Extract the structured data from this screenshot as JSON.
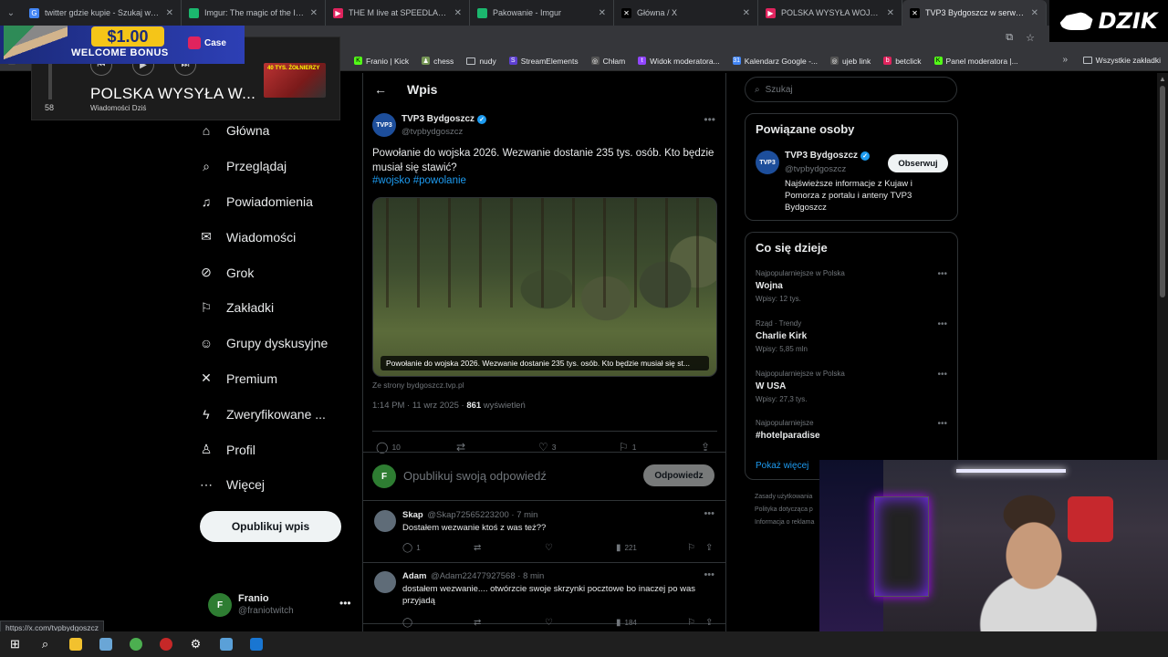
{
  "browser": {
    "tabs": [
      {
        "title": "twitter gdzie kupie - Szukaj w Google",
        "favicon_color": "#4285f4",
        "active": false
      },
      {
        "title": "Imgur: The magic of the Internet",
        "favicon_color": "#1bb76e",
        "active": false
      },
      {
        "title": "THE M live at SPEEDLAND FESTIVAL",
        "favicon_color": "#e0245e",
        "active": false
      },
      {
        "title": "Pakowanie - Imgur",
        "favicon_color": "#1bb76e",
        "active": false
      },
      {
        "title": "Główna / X",
        "favicon_color": "#000000",
        "active": false
      },
      {
        "title": "POLSKA WYSYŁA WOJSKO - 40",
        "favicon_color": "#e0245e",
        "active": false
      },
      {
        "title": "TVP3 Bydgoszcz w serwisie X",
        "favicon_color": "#000000",
        "active": true
      }
    ],
    "bookmarks": [
      {
        "label": "Franio | Kick",
        "color": "#53fc18"
      },
      {
        "label": "chess",
        "color": "#769656"
      },
      {
        "label": "nudy",
        "color": "#888888"
      },
      {
        "label": "StreamElements",
        "color": "#5d3fd3"
      },
      {
        "label": "Chłam",
        "color": "#888888"
      },
      {
        "label": "Widok moderatora...",
        "color": "#9146ff"
      },
      {
        "label": "Kalendarz Google -...",
        "color": "#4285f4"
      },
      {
        "label": "ujeb link",
        "color": "#888888"
      },
      {
        "label": "betclick",
        "color": "#e0245e"
      },
      {
        "label": "Panel moderatora |...",
        "color": "#53fc18"
      }
    ],
    "all_bookmarks": "Wszystkie zakładki",
    "status_url": "https://x.com/tvpbydgoszcz"
  },
  "overlays": {
    "dzik": "DZIK",
    "promo": {
      "amount": "$1.00",
      "bonus": "WELCOME BONUS",
      "brand": "Case"
    },
    "media": {
      "title": "POLSKA WYSYŁA W...",
      "source": "Wiadomości Dziś",
      "volume": "58",
      "thumb_text": "40 TYS. ŻOŁNIERZY"
    }
  },
  "nav": {
    "items": [
      {
        "label": "Główna",
        "icon": "home-icon",
        "glyph": "⌂"
      },
      {
        "label": "Przeglądaj",
        "icon": "search-icon",
        "glyph": "⌕"
      },
      {
        "label": "Powiadomienia",
        "icon": "bell-icon",
        "glyph": "♫"
      },
      {
        "label": "Wiadomości",
        "icon": "mail-icon",
        "glyph": "✉"
      },
      {
        "label": "Grok",
        "icon": "grok-icon",
        "glyph": "⊘"
      },
      {
        "label": "Zakładki",
        "icon": "bookmark-icon",
        "glyph": "⚐"
      },
      {
        "label": "Grupy dyskusyjne",
        "icon": "communities-icon",
        "glyph": "☺"
      },
      {
        "label": "Premium",
        "icon": "x-logo-icon",
        "glyph": "✕"
      },
      {
        "label": "Zweryfikowane ...",
        "icon": "lightning-icon",
        "glyph": "ϟ"
      },
      {
        "label": "Profil",
        "icon": "profile-icon",
        "glyph": "♙"
      },
      {
        "label": "Więcej",
        "icon": "more-circle-icon",
        "glyph": "⋯"
      }
    ],
    "post_button": "Opublikuj wpis",
    "account": {
      "name": "Franio",
      "handle": "@franiotwitch"
    }
  },
  "main": {
    "header": "Wpis",
    "tweet": {
      "author": "TVP3 Bydgoszcz",
      "handle": "@tvpbydgoszcz",
      "text": "Powołanie do wojska 2026. Wezwanie dostanie 235 tys. osób. Kto będzie musiał się stawić?",
      "hashtags": "#wojsko #powolanie",
      "image_caption": "Powołanie do wojska 2026. Wezwanie dostanie 235 tys. osób. Kto będzie musiał się st...",
      "source": "Ze strony bydgoszcz.tvp.pl",
      "time": "1:14 PM · 11 wrz 2025 · ",
      "views_count": "861",
      "views_label": " wyświetleń",
      "replies": "10",
      "reposts": "",
      "likes": "3",
      "bookmarks": "1"
    },
    "reply_box": {
      "placeholder": "Opublikuj swoją odpowiedź",
      "button": "Odpowiedz"
    },
    "replies": [
      {
        "name": "Skap",
        "handle": "@Skap72565223200 · 7 min",
        "text": "Dostałem wezwanie ktoś z was też??",
        "replies": "1",
        "views": "221"
      },
      {
        "name": "Adam",
        "handle": "@Adam22477927568 · 8 min",
        "text": "dostałem wezwanie.... otwórzcie swoje skrzynki pocztowe bo inaczej po was przyjadą",
        "replies": "",
        "views": "184"
      }
    ]
  },
  "right": {
    "search_placeholder": "Szukaj",
    "related": {
      "title": "Powiązane osoby",
      "name": "TVP3 Bydgoszcz",
      "handle": "@tvpbydgoszcz",
      "follow": "Obserwuj",
      "bio": "Najświeższe informacje z Kujaw i Pomorza z portalu i anteny TVP3 Bydgoszcz"
    },
    "trends_title": "Co się dzieje",
    "trends": [
      {
        "category": "Najpopularniejsze w Polska",
        "name": "Wojna",
        "count": "Wpisy: 12 tys."
      },
      {
        "category": "Rząd · Trendy",
        "name": "Charlie Kirk",
        "count": "Wpisy: 5,85 mln"
      },
      {
        "category": "Najpopularniejsze w Polska",
        "name": "W USA",
        "count": "Wpisy: 27,3 tys."
      },
      {
        "category": "Najpopularniejsze",
        "name": "#hotelparadise",
        "count": ""
      }
    ],
    "show_more": "Pokaż więcej",
    "footer": [
      "Zasady użytkowania",
      "Polityka dotycząca p",
      "Informacja o reklama"
    ]
  }
}
